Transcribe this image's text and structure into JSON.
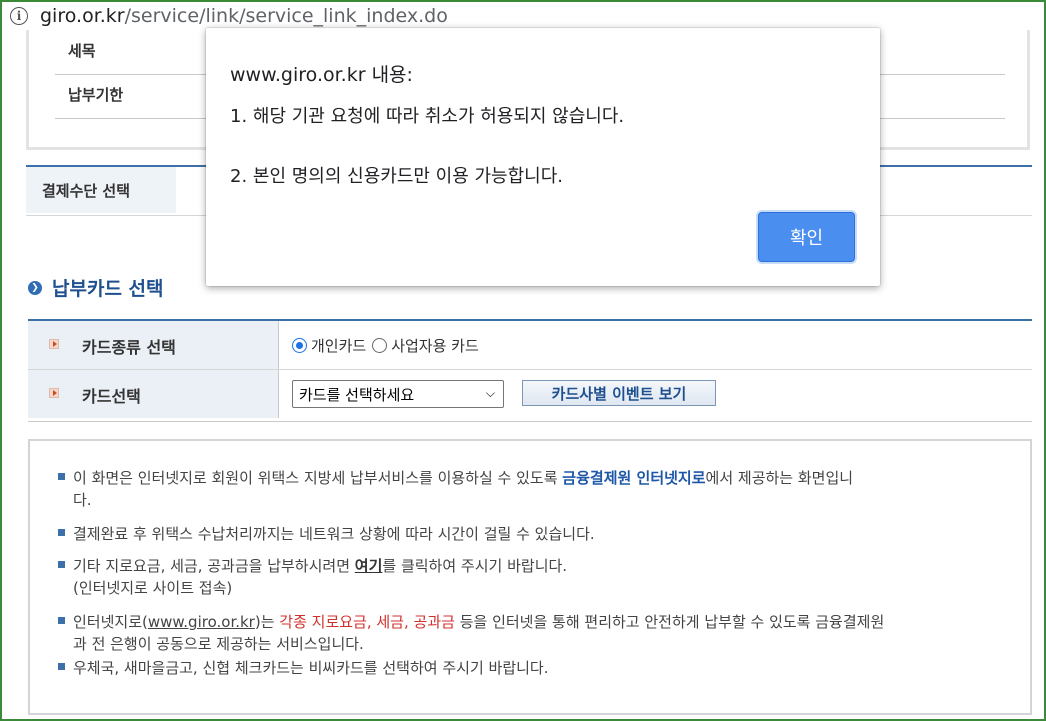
{
  "browser": {
    "url_host": "giro.or.kr",
    "url_path": "/service/link/service_link_index.do"
  },
  "summary": {
    "rows": [
      {
        "label": "세목"
      },
      {
        "label": "납부기한"
      }
    ]
  },
  "payment_method": {
    "label": "결제수단 선택"
  },
  "card_section": {
    "title": "납부카드 선택",
    "card_type_label": "카드종류 선택",
    "radio_personal": "개인카드",
    "radio_business": "사업자용 카드",
    "selected_card_type": "개인카드",
    "card_select_label": "카드선택",
    "card_select_value": "카드를 선택하세요",
    "event_button": "카드사별 이벤트 보기"
  },
  "notice": {
    "l1_a": "이 화면은 인터넷지로 회원이 위택스 지방세 납부서비스를 이용하실 수 있도록 ",
    "l1_b": "금융결제원 인터넷지로",
    "l1_c": "에서 제공하는 화면입니",
    "l1_d": "다.",
    "l2": "결제완료 후 위택스 수납처리까지는 네트워크 상황에 따라 시간이 걸릴 수 있습니다.",
    "l3_a": "기타 지로요금, 세금, 공과금을 납부하시려면 ",
    "l3_b": "여기",
    "l3_c": "를 클릭하여 주시기 바랍니다.",
    "l3_d": "(인터넷지로 사이트 접속)",
    "l4_a": "인터넷지로(",
    "l4_link": "www.giro.or.kr",
    "l4_b": ")는 ",
    "l4_red": "각종 지로요금, 세금, 공과금",
    "l4_c": " 등을 인터넷을 통해 편리하고 안전하게 납부할 수 있도록 금융결제원",
    "l4_d": "과 전 은행이 공동으로 제공하는 서비스입니다.",
    "l5": "우체국, 새마을금고, 신협 체크카드는 비씨카드를 선택하여 주시기 바랍니다."
  },
  "dialog": {
    "title": "www.giro.or.kr 내용:",
    "msg1": "1. 해당 기관 요청에 따라 취소가 허용되지 않습니다.",
    "msg2": "2. 본인 명의의 신용카드만 이용 가능합니다.",
    "ok": "확인"
  },
  "colors": {
    "accent": "#3d6fa8",
    "dialog_button": "#4a8ff0",
    "frame": "#3a8a3a"
  }
}
